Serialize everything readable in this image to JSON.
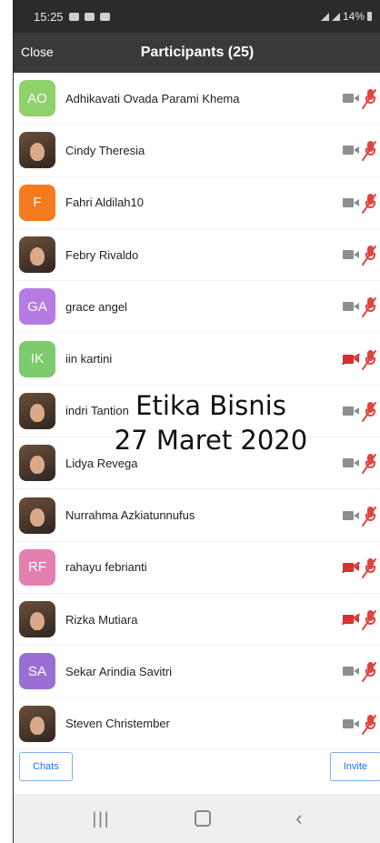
{
  "status_bar": {
    "time": "15:25",
    "battery": "14%"
  },
  "header": {
    "close_label": "Close",
    "title": "Participants (25)"
  },
  "participants": [
    {
      "name": "Adhikavati Ovada Parami Khema",
      "initials": "AO",
      "avatar_color": "#8fd16a",
      "video": "on"
    },
    {
      "name": "Cindy Theresia",
      "initials": "",
      "avatar_color": "",
      "video": "on"
    },
    {
      "name": "Fahri Aldilah10",
      "initials": "F",
      "avatar_color": "#f47b1f",
      "video": "on"
    },
    {
      "name": "Febry Rivaldo",
      "initials": "",
      "avatar_color": "",
      "video": "on"
    },
    {
      "name": "grace angel",
      "initials": "GA",
      "avatar_color": "#b57be3",
      "video": "on"
    },
    {
      "name": "iin kartini",
      "initials": "IK",
      "avatar_color": "#7ccb6c",
      "video": "off"
    },
    {
      "name": "indri Tantion",
      "initials": "",
      "avatar_color": "",
      "video": "on"
    },
    {
      "name": "Lidya Revega",
      "initials": "",
      "avatar_color": "",
      "video": "on"
    },
    {
      "name": "Nurrahma Azkiatunnufus",
      "initials": "",
      "avatar_color": "",
      "video": "on"
    },
    {
      "name": "rahayu febrianti",
      "initials": "RF",
      "avatar_color": "#e57fb0",
      "video": "off"
    },
    {
      "name": "Rizka Mutiara",
      "initials": "",
      "avatar_color": "",
      "video": "off"
    },
    {
      "name": "Sekar Arindia Savitri",
      "initials": "SA",
      "avatar_color": "#9a6fd4",
      "video": "on"
    },
    {
      "name": "Steven Christember",
      "initials": "",
      "avatar_color": "",
      "video": "on"
    }
  ],
  "overlay": {
    "line1": "Etika Bisnis",
    "line2": "27 Maret 2020"
  },
  "buttons": {
    "chats_label": "Chats",
    "invite_label": "Invite"
  },
  "colors": {
    "header_bg": "#3a3a3c",
    "mic_muted": "#e0443f",
    "video_off": "#d63031",
    "button_text": "#1a73e8"
  }
}
